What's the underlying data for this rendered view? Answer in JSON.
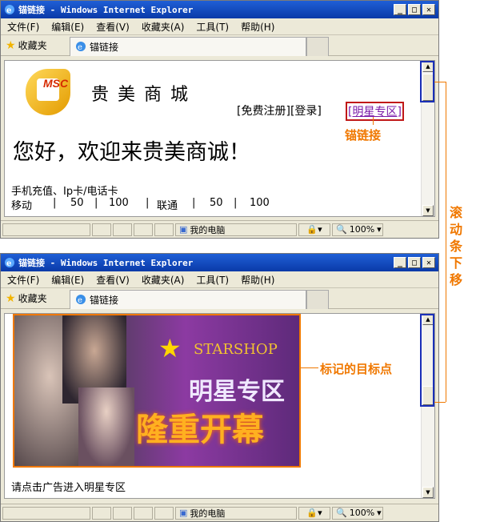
{
  "windows": [
    {
      "title": "锚链接 - Windows Internet Explorer",
      "menus": [
        "文件(F)",
        "编辑(E)",
        "查看(V)",
        "收藏夹(A)",
        "工具(T)",
        "帮助(H)"
      ],
      "favorites_label": "收藏夹",
      "tab_label": "锚链接",
      "status_zone": "我的电脑",
      "zoom": "100%"
    },
    {
      "title": "锚链接 - Windows Internet Explorer",
      "menus": [
        "文件(F)",
        "编辑(E)",
        "查看(V)",
        "收藏夹(A)",
        "工具(T)",
        "帮助(H)"
      ],
      "favorites_label": "收藏夹",
      "tab_label": "锚链接",
      "status_zone": "我的电脑",
      "zoom": "100%"
    }
  ],
  "page1": {
    "logo_text": "MSC",
    "store_name": "贵 美 商 城",
    "top_links": [
      "[免费注册]",
      "[登录]"
    ],
    "anchor_link": "[明星专区]",
    "welcome": "您好，欢迎来贵美商诚！",
    "recharge_title": "手机充值、Ip卡/电话卡",
    "recharge_row": [
      "移动",
      "|",
      "50",
      "|",
      "100",
      "|",
      "联通",
      "|",
      "50",
      "|",
      "100"
    ]
  },
  "page2": {
    "banner_brand": "STARSHOP",
    "banner_title1": "明星专区",
    "banner_title2": "隆重开幕",
    "footer_text": "请点击广告进入明星专区"
  },
  "annotations": {
    "anchor_label": "锚链接",
    "scroll_label": "滚动条下移",
    "target_label": "标记的目标点",
    "accent": "#f07800",
    "highlight": "#1a2fb8"
  }
}
